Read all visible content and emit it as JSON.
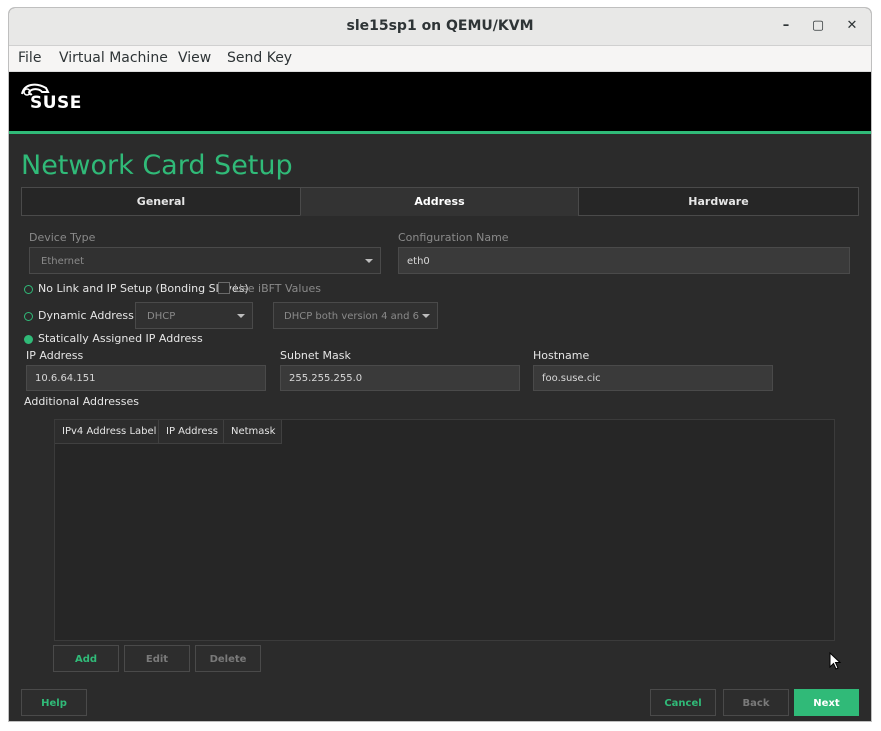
{
  "window": {
    "title": "sle15sp1 on QEMU/KVM"
  },
  "controls": {
    "minimize": "–",
    "maximize": "▢",
    "close": "✕"
  },
  "menubar": {
    "items": [
      "File",
      "Virtual Machine",
      "View",
      "Send Key"
    ]
  },
  "banner": {
    "logo": "SUSE"
  },
  "page": {
    "heading": "Network Card Setup"
  },
  "tabs": [
    {
      "label": "General",
      "active": false
    },
    {
      "label": "Address",
      "active": true
    },
    {
      "label": "Hardware",
      "active": false
    }
  ],
  "device": {
    "type_label": "Device Type",
    "type_value": "Ethernet",
    "config_label": "Configuration Name",
    "config_value": "eth0"
  },
  "options": {
    "nolink_label": "No Link and IP Setup (Bonding Slaves)",
    "ibft_label": "Use iBFT Values",
    "dynamic_label": "Dynamic Address",
    "dhcp_value": "DHCP",
    "dhcp_version_value": "DHCP both version 4 and 6",
    "static_label": "Statically Assigned IP Address",
    "selected": "static"
  },
  "static": {
    "ip_label": "IP Address",
    "ip_value": "10.6.64.151",
    "mask_label": "Subnet Mask",
    "mask_value": "255.255.255.0",
    "host_label": "Hostname",
    "host_value": "foo.suse.cic"
  },
  "additional": {
    "title": "Additional Addresses",
    "columns": [
      "IPv4 Address Label",
      "IP Address",
      "Netmask"
    ],
    "rows": []
  },
  "table_buttons": {
    "add": "Add",
    "edit": "Edit",
    "delete": "Delete"
  },
  "footer": {
    "help": "Help",
    "cancel": "Cancel",
    "back": "Back",
    "next": "Next"
  },
  "colors": {
    "accent": "#30ba78",
    "background": "#2b2b2b",
    "banner": "#000000"
  }
}
